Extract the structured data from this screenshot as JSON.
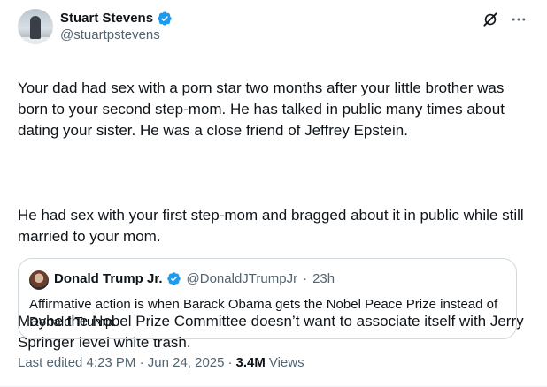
{
  "author": {
    "display_name": "Stuart Stevens",
    "handle": "@stuartpstevens",
    "verified_icon": "verified-badge-icon"
  },
  "tweet": {
    "paragraph1": "Your dad had sex with a porn star two months after your little brother was born to your second step-mom. He has talked in public many times about dating your sister. He was a close friend of Jeffrey Epstein.",
    "paragraph2": "He had sex with your first step-mom and bragged about it in public while still married to your mom.",
    "paragraph3": "Maybe the Nobel Prize Committee doesn’t want to associate itself with Jerry Springer level white trash."
  },
  "quote": {
    "display_name": "Donald Trump Jr.",
    "handle": "@DonaldJTrumpJr",
    "separator": "·",
    "time": "23h",
    "text": "Affirmative action is when Barack Obama gets the Nobel Peace Prize instead of Donald Trump."
  },
  "meta": {
    "edited_label": "Last edited 4:23 PM · Jun 24, 2025",
    "separator": "·",
    "views_count": "3.4M",
    "views_label": "Views"
  },
  "colors": {
    "accent": "#1d9bf0",
    "text": "#0f1419",
    "secondary": "#536471",
    "border": "#cfd9de"
  }
}
